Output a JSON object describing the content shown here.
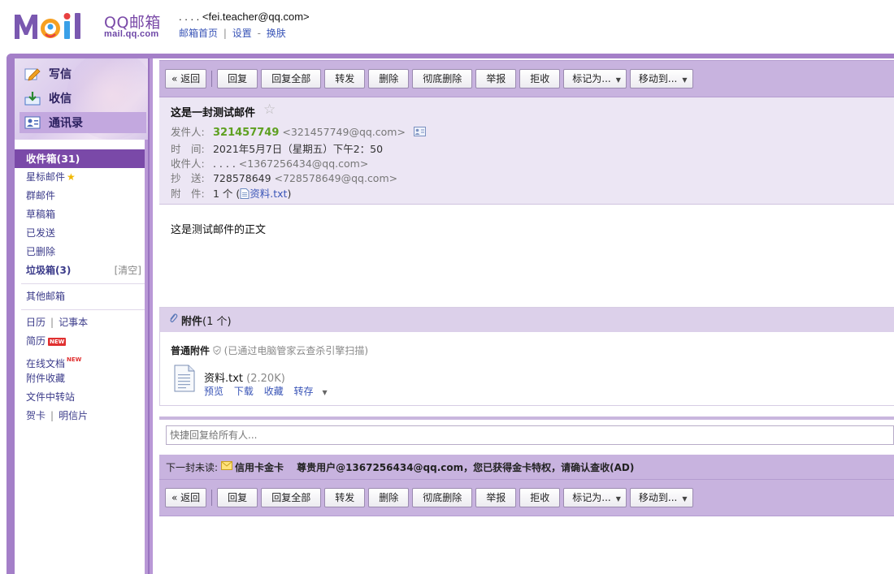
{
  "header": {
    "brand_cn": "QQ邮箱",
    "brand_domain": "mail.qq.com",
    "user_account": ". . . .  <fei.teacher@qq.com>",
    "links": [
      "邮箱首页",
      "设置",
      "换肤"
    ],
    "link_sep": "|",
    "link_dash": "-"
  },
  "sidebar": {
    "quick_actions": [
      {
        "label": "写信",
        "icon": "pencil-icon"
      },
      {
        "label": "收信",
        "icon": "inbox-download-icon"
      },
      {
        "label": "通讯录",
        "icon": "address-book-icon"
      }
    ],
    "folders": {
      "inbox": "收件箱(31)",
      "starred": "星标邮件",
      "group": "群邮件",
      "drafts": "草稿箱",
      "sent": "已发送",
      "deleted": "已删除",
      "spam": "垃圾箱(3)",
      "spam_clear": "[清空]",
      "other": "其他邮箱"
    },
    "tools": {
      "calendar": "日历",
      "notes": "记事本",
      "resume": "简历",
      "resume_badge": "NEW",
      "docs": "在线文档",
      "docs_badge": "NEW",
      "attach_fav": "附件收藏",
      "file_transfer": "文件中转站",
      "cards": "贺卡",
      "postcard": "明信片",
      "pipe": "|"
    }
  },
  "toolbar": {
    "back": "« 返回",
    "reply": "回复",
    "reply_all": "回复全部",
    "forward": "转发",
    "delete": "删除",
    "delete_perm": "彻底删除",
    "report": "举报",
    "reject": "拒收",
    "mark_as": "标记为...",
    "move_to": "移动到..."
  },
  "mail": {
    "subject": "这是一封测试邮件",
    "labels": {
      "from": "发件人:",
      "time": "时　间:",
      "to": "收件人:",
      "cc": "抄　送:",
      "attach": "附　件:"
    },
    "from_name": "321457749",
    "from_addr": "<321457749@qq.com>",
    "time": "2021年5月7日（星期五）下午2：50",
    "to_name": ". . . .",
    "to_addr": "<1367256434@qq.com>",
    "cc_name": "728578649",
    "cc_addr": "<728578649@qq.com>",
    "attach_count": "1 个 (",
    "attach_close": ")",
    "attach_name": "资料.txt",
    "body": "这是测试邮件的正文"
  },
  "attachments": {
    "title": "附件",
    "count": "(1 个)",
    "kind_label": "普通附件",
    "scan_note": "(已通过电脑管家云查杀引擎扫描)",
    "file": {
      "name": "资料.txt",
      "size": "(2.20K)",
      "actions": [
        "预览",
        "下载",
        "收藏",
        "转存"
      ]
    }
  },
  "quick_reply": {
    "placeholder": "快捷回复给所有人..."
  },
  "next_unread": {
    "label": "下一封未读:",
    "subject": "信用卡金卡",
    "preview": "尊贵用户@1367256434@qq.com，您已获得金卡特权，请确认查收(AD)"
  },
  "colors": {
    "brand_purple": "#7a49a8",
    "toolbar_bg": "#c8b3df",
    "header_bg": "#ece6f4",
    "link_blue": "#3a55b7",
    "sender_green": "#5ea021"
  }
}
